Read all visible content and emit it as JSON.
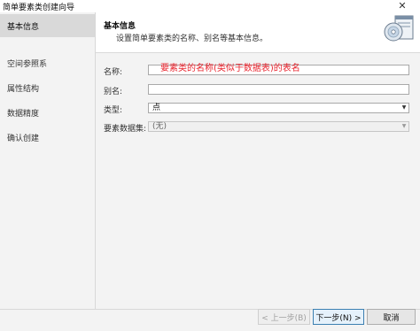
{
  "window": {
    "title": "简单要素类创建向导",
    "close_glyph": "✕"
  },
  "sidebar": {
    "items": [
      {
        "label": "基本信息",
        "active": true
      },
      {
        "label": "空间参照系",
        "active": false
      },
      {
        "label": "属性结构",
        "active": false
      },
      {
        "label": "数据精度",
        "active": false
      },
      {
        "label": "确认创建",
        "active": false
      }
    ]
  },
  "header": {
    "title": "基本信息",
    "description": "设置简单要素类的名称、别名等基本信息。",
    "icon": "disc-and-window-icon"
  },
  "form": {
    "name_label": "名称:",
    "name_value": "",
    "alias_label": "别名:",
    "alias_value": "",
    "type_label": "类型:",
    "type_value": "点",
    "dataset_label": "要素数据集:",
    "dataset_value": "(无)"
  },
  "annotation": {
    "text": "要素类的名称(类似于数据表)的表名",
    "color": "#e8212b"
  },
  "footer": {
    "prev_label": "< 上一步(B)",
    "next_label": "下一步(N) >",
    "cancel_label": "取消"
  }
}
